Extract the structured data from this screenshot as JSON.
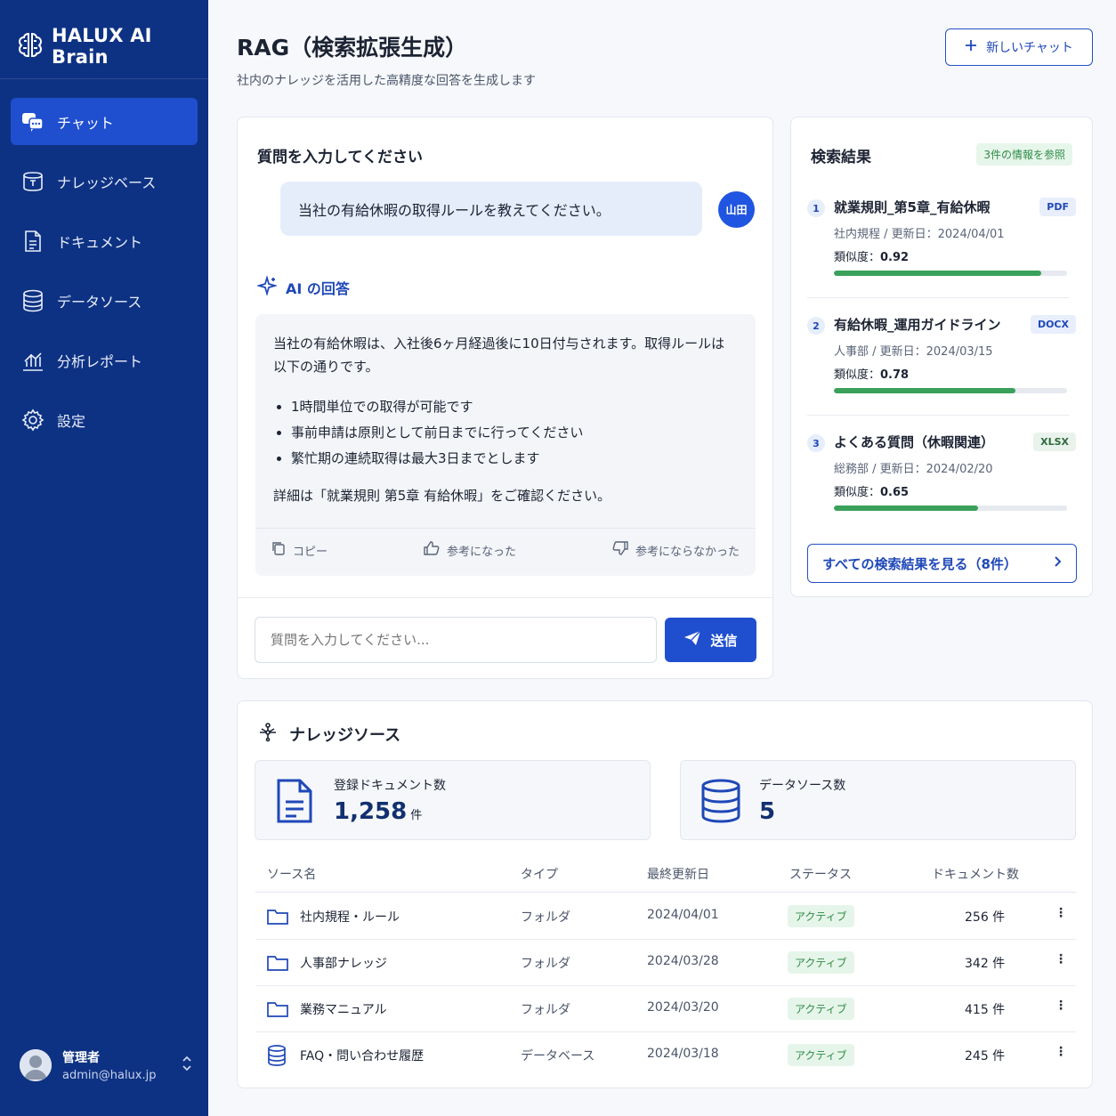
{
  "brand": {
    "name": "HALUX AI Brain"
  },
  "nav": {
    "items": [
      {
        "label": "チャット",
        "icon": "chat-icon"
      },
      {
        "label": "ナレッジベース",
        "icon": "knowledge-icon"
      },
      {
        "label": "ドキュメント",
        "icon": "document-icon"
      },
      {
        "label": "データソース",
        "icon": "database-icon"
      },
      {
        "label": "分析レポート",
        "icon": "chart-icon"
      },
      {
        "label": "設定",
        "icon": "gear-icon"
      }
    ],
    "active": "チャット"
  },
  "user": {
    "name": "管理者",
    "email": "admin@halux.jp"
  },
  "header": {
    "title": "RAG（検索拡張生成）",
    "subtitle": "社内のナレッジを活用した高精度な回答を生成します",
    "new_chat": "新しいチャット"
  },
  "chat": {
    "heading": "質問を入力してください",
    "question": "当社の有給休暇の取得ルールを教えてください。",
    "user_badge": "山田",
    "ai_label": "AI の回答",
    "answer_intro": "当社の有給休暇は、入社後6ヶ月経過後に10日付与されます。取得ルールは以下の通りです。",
    "answer_points": [
      "1時間単位での取得が可能です",
      "事前申請は原則として前日までに行ってください",
      "繁忙期の連続取得は最大3日までとします"
    ],
    "answer_outro": "詳細は「就業規則 第5章 有給休暇」をご確認ください。",
    "actions": {
      "copy": "コピー",
      "helpful": "参考になった",
      "not_helpful": "参考にならなかった"
    },
    "input_placeholder": "質問を入力してください...",
    "send": "送信"
  },
  "results": {
    "heading": "検索結果",
    "badge": "3件の情報を参照",
    "items": [
      {
        "num": "1",
        "title": "就業規則_第5章_有給休暇",
        "type": "PDF",
        "meta": "社内規程 / 更新日：2024/04/01",
        "similarity_label": "類似度：",
        "similarity": "0.92",
        "fill": 0.89
      },
      {
        "num": "2",
        "title": "有給休暇_運用ガイドライン",
        "type": "DOCX",
        "meta": "人事部 / 更新日：2024/03/15",
        "similarity_label": "類似度：",
        "similarity": "0.78",
        "fill": 0.78
      },
      {
        "num": "3",
        "title": "よくある質問（休暇関連）",
        "type": "XLSX",
        "meta": "総務部 / 更新日：2024/02/20",
        "similarity_label": "類似度：",
        "similarity": "0.65",
        "fill": 0.62
      }
    ],
    "type_colors": {
      "PDF": "#1f48b8",
      "DOCX": "#1f48b8",
      "XLSX": "#2e6b3d"
    },
    "all_results": "すべての検索結果を見る（8件）"
  },
  "knowledge": {
    "title": "ナレッジソース",
    "stats": [
      {
        "label": "登録ドキュメント数",
        "value": "1,258",
        "unit": "件"
      },
      {
        "label": "データソース数",
        "value": "5",
        "unit": ""
      }
    ],
    "columns": [
      "ソース名",
      "タイプ",
      "最終更新日",
      "ステータス",
      "ドキュメント数"
    ],
    "rows": [
      {
        "name": "社内規程・ルール",
        "type": "フォルダ",
        "updated": "2024/04/01",
        "status": "アクティブ",
        "docs": "256 件",
        "icon": "folder-icon"
      },
      {
        "name": "人事部ナレッジ",
        "type": "フォルダ",
        "updated": "2024/03/28",
        "status": "アクティブ",
        "docs": "342 件",
        "icon": "folder-icon"
      },
      {
        "name": "業務マニュアル",
        "type": "フォルダ",
        "updated": "2024/03/20",
        "status": "アクティブ",
        "docs": "415 件",
        "icon": "folder-icon"
      },
      {
        "name": "FAQ・問い合わせ履歴",
        "type": "データベース",
        "updated": "2024/03/18",
        "status": "アクティブ",
        "docs": "245 件",
        "icon": "database-icon"
      }
    ]
  }
}
